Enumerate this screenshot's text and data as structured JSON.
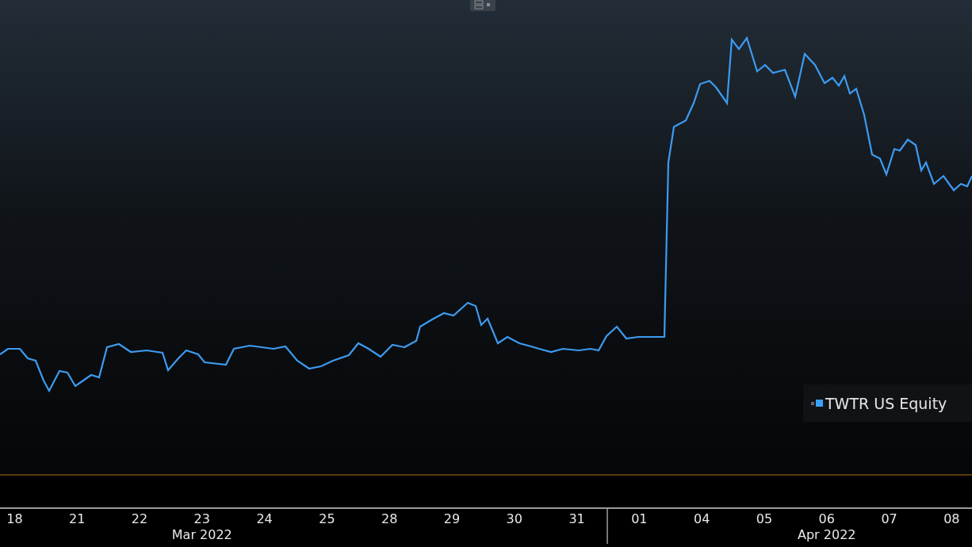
{
  "chart": {
    "legend": [
      {
        "label": "TWTR US Equity"
      }
    ]
  },
  "x_axis": {
    "ticks": [
      "18",
      "21",
      "22",
      "23",
      "24",
      "25",
      "28",
      "29",
      "30",
      "31",
      "01",
      "04",
      "05",
      "06",
      "07",
      "08"
    ],
    "months": [
      {
        "label": "Mar 2022"
      },
      {
        "label": "Apr 2022"
      }
    ]
  }
}
